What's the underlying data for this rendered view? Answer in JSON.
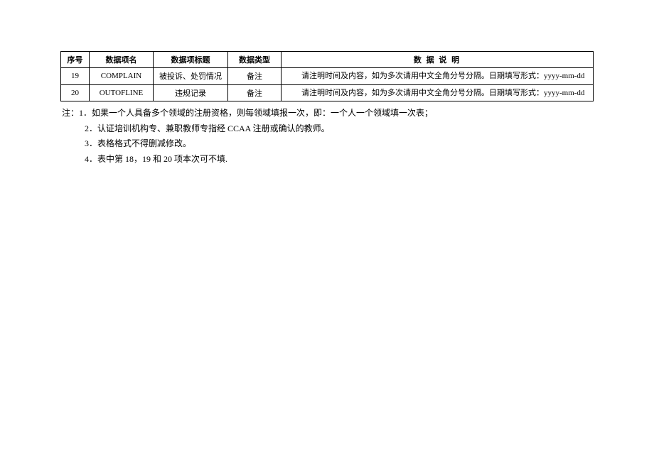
{
  "table": {
    "headers": {
      "col1": "序号",
      "col2": "数据项名",
      "col3": "数据项标题",
      "col4": "数据类型",
      "col5": "数 据 说 明"
    },
    "rows": [
      {
        "seq": "19",
        "name": "COMPLAIN",
        "title": "被投诉、处罚情况",
        "type": "备注",
        "desc": "　　请注明时间及内容，如为多次请用中文全角分号分隔。日期填写形式：yyyy-mm-dd"
      },
      {
        "seq": "20",
        "name": "OUTOFLINE",
        "title": "违规记录",
        "type": "备注",
        "desc": "　　请注明时间及内容，如为多次请用中文全角分号分隔。日期填写形式：yyyy-mm-dd"
      }
    ]
  },
  "notes": {
    "n1": "注：1．如果一个人具备多个领域的注册资格，则每领域填报一次，即：一个人一个领域填一次表；",
    "n2": "2．认证培训机构专、兼职教师专指经 CCAA 注册或确认的教师。",
    "n3": "3．表格格式不得删减修改。",
    "n4": "4．表中第 18，19 和 20 项本次可不填."
  }
}
